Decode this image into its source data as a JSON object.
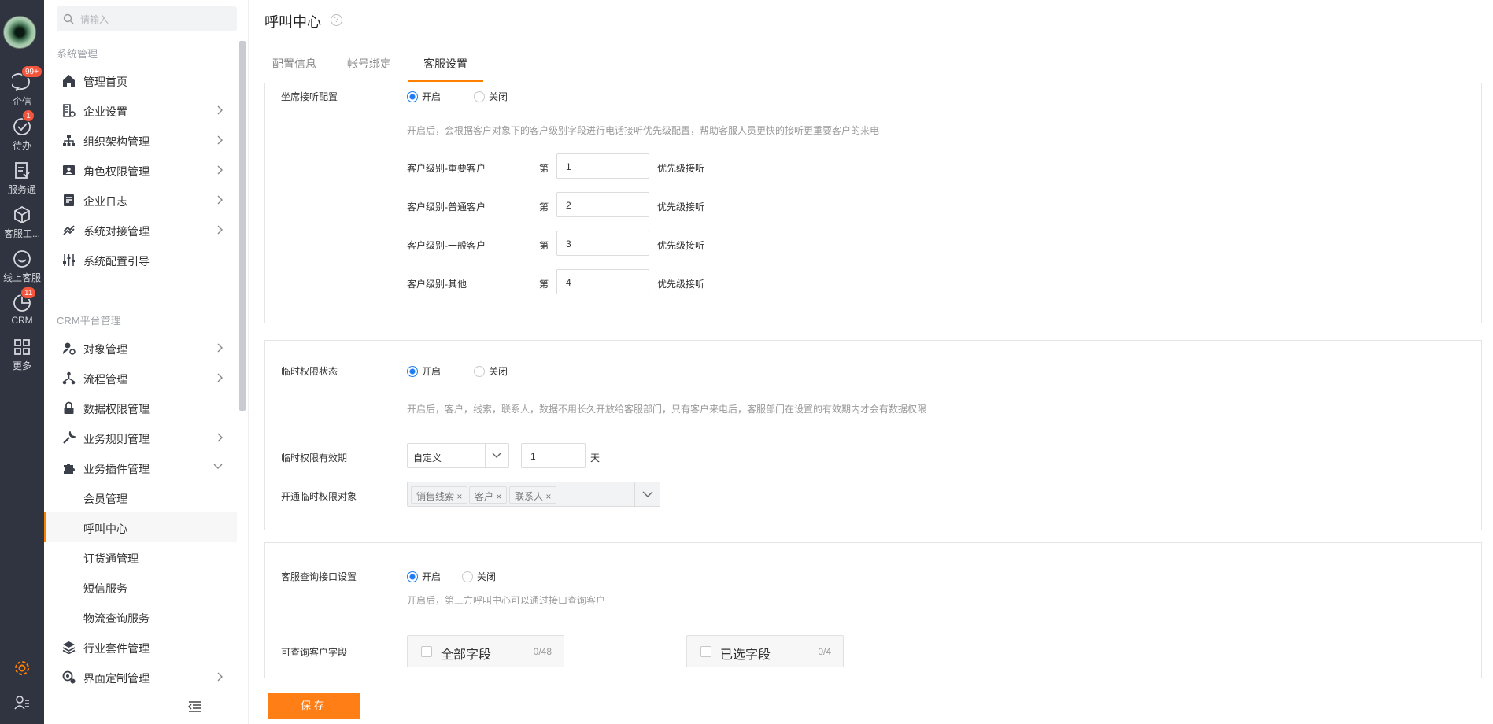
{
  "rail": {
    "items": [
      {
        "label": "企信",
        "badge": "99+",
        "icon": "chat-icon"
      },
      {
        "label": "待办",
        "badge": "1",
        "icon": "check-circle-icon"
      },
      {
        "label": "服务通",
        "badge": "",
        "icon": "service-doc-icon"
      },
      {
        "label": "客服工...",
        "badge": "",
        "icon": "cube-icon"
      },
      {
        "label": "线上客服",
        "badge": "",
        "icon": "smile-chat-icon"
      },
      {
        "label": "CRM",
        "badge": "11",
        "icon": "pie-icon"
      },
      {
        "label": "更多",
        "badge": "",
        "icon": "grid-icon"
      }
    ],
    "accent": "#ff8000"
  },
  "sidebar": {
    "search_placeholder": "请输入",
    "group1_title": "系统管理",
    "group1": [
      {
        "label": "管理首页",
        "icon": "home-icon"
      },
      {
        "label": "企业设置",
        "icon": "building-icon"
      },
      {
        "label": "组织架构管理",
        "icon": "org-chart-icon"
      },
      {
        "label": "角色权限管理",
        "icon": "id-card-icon"
      },
      {
        "label": "企业日志",
        "icon": "log-icon"
      },
      {
        "label": "系统对接管理",
        "icon": "link-icon"
      },
      {
        "label": "系统配置引导",
        "icon": "sliders-icon"
      }
    ],
    "group2_title": "CRM平台管理",
    "group2": [
      {
        "label": "对象管理",
        "icon": "user-gear-icon"
      },
      {
        "label": "流程管理",
        "icon": "flow-icon"
      },
      {
        "label": "数据权限管理",
        "icon": "lock-icon"
      },
      {
        "label": "业务规则管理",
        "icon": "wrench-icon"
      },
      {
        "label": "业务插件管理",
        "icon": "puzzle-icon"
      }
    ],
    "plugin_subs": [
      "会员管理",
      "呼叫中心",
      "订货通管理",
      "短信服务",
      "物流查询服务"
    ],
    "group3": [
      {
        "label": "行业套件管理",
        "icon": "layers-icon"
      },
      {
        "label": "界面定制管理",
        "icon": "customize-icon"
      }
    ]
  },
  "page": {
    "title": "呼叫中心",
    "tabs": [
      "配置信息",
      "帐号绑定",
      "客服设置"
    ],
    "active_tab": "客服设置"
  },
  "section1": {
    "label": "坐席接听配置",
    "on": "开启",
    "off": "关闭",
    "selected": "开启",
    "desc": "开启后，会根据客户对象下的客户级别字段进行电话接听优先级配置，帮助客服人员更快的接听更重要客户的来电",
    "prefix": "第",
    "suffix": "优先级接听",
    "levels": [
      {
        "name": "客户级别-重要客户",
        "value": "1"
      },
      {
        "name": "客户级别-普通客户",
        "value": "2"
      },
      {
        "name": "客户级别-一般客户",
        "value": "3"
      },
      {
        "name": "客户级别-其他",
        "value": "4"
      }
    ]
  },
  "section2": {
    "label": "临时权限状态",
    "on": "开启",
    "off": "关闭",
    "selected": "开启",
    "desc": "开启后，客户，线索，联系人，数据不用长久开放给客服部门，只有客户来电后，客服部门在设置的有效期内才会有数据权限",
    "validity_label": "临时权限有效期",
    "validity_type": "自定义",
    "validity_value": "1",
    "validity_unit": "天",
    "objects_label": "开通临时权限对象",
    "objects": [
      "销售线索",
      "客户",
      "联系人"
    ]
  },
  "section3": {
    "label": "客服查询接口设置",
    "on": "开启",
    "off": "关闭",
    "selected": "开启",
    "desc": "开启后，第三方呼叫中心可以通过接口查询客户",
    "fields_label": "可查询客户字段",
    "all_fields": "全部字段",
    "all_count": "0/48",
    "selected_fields": "已选字段",
    "selected_count": "0/4"
  },
  "footer": {
    "save": "保存"
  }
}
